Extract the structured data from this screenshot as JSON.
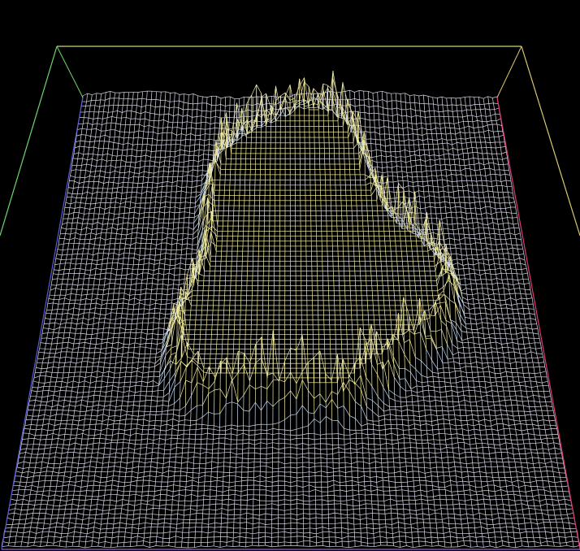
{
  "scene": {
    "background_color": "#000000",
    "colors": {
      "mesh_low": "#d8d8e8",
      "mesh_high": "#f2eca0",
      "mesh_mid": "#c8dcf0",
      "box_top": "#c8d87a",
      "box_left_top": "#6fd66f",
      "box_left_bottom": "#5a5ad8",
      "box_right_top": "#d8c870",
      "box_right_bottom": "#e03a7a",
      "box_bottom": "#a060d0"
    },
    "mesh": {
      "rows": 90,
      "cols": 90,
      "description_type": "wireframe-height-field"
    },
    "icons": {
      "bounding_box": "wireframe-box-icon"
    }
  }
}
